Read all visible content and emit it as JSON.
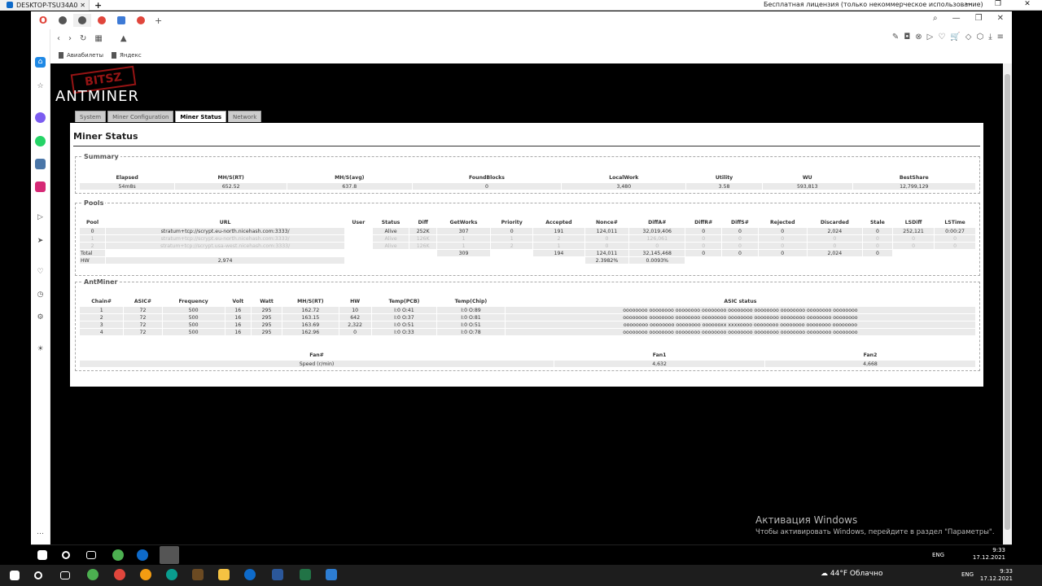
{
  "tv": {
    "tab_title": "DESKTOP-TSU34A0",
    "license": "Бесплатная лицензия (только некоммерческое использование)",
    "plus": "+"
  },
  "browser": {
    "bookmarks": [
      "Авиабилеты",
      "Яндекс"
    ]
  },
  "page": {
    "brand": "ANTMINER",
    "stamp": "BITSZ",
    "tabs": [
      "System",
      "Miner Configuration",
      "Miner Status",
      "Network"
    ],
    "active_tab": "Miner Status",
    "title": "Miner Status"
  },
  "summary": {
    "legend": "Summary",
    "headers": [
      "Elapsed",
      "MH/S(RT)",
      "MH/S(avg)",
      "FoundBlocks",
      "LocalWork",
      "Utility",
      "WU",
      "BestShare"
    ],
    "values": [
      "54m8s",
      "652.52",
      "637.8",
      "0",
      "3,480",
      "3.58",
      "593,813",
      "12,799,129"
    ]
  },
  "pools": {
    "legend": "Pools",
    "headers": [
      "Pool",
      "URL",
      "User",
      "Status",
      "Diff",
      "GetWorks",
      "Priority",
      "Accepted",
      "Nonce#",
      "DiffA#",
      "DiffR#",
      "DiffS#",
      "Rejected",
      "Discarded",
      "Stale",
      "LSDiff",
      "LSTime"
    ],
    "rows": [
      [
        "0",
        "stratum+tcp://scrypt.eu-north.nicehash.com:3333/",
        "",
        "Alive",
        "252K",
        "307",
        "0",
        "191",
        "124,011",
        "32,019,406",
        "0",
        "0",
        "0",
        "2,024",
        "0",
        "252,121",
        "0:00:27"
      ],
      [
        "1",
        "stratum+tcp://scrypt.eu-north.nicehash.com:3333/",
        "",
        "Alive",
        "126K",
        "1",
        "1",
        "2",
        "0",
        "126,061",
        "0",
        "0",
        "0",
        "0",
        "0",
        "0",
        "0"
      ],
      [
        "2",
        "stratum+tcp://scrypt.usa-west.nicehash.com:3333/",
        "",
        "Alive",
        "126K",
        "1",
        "2",
        "1",
        "0",
        "0",
        "0",
        "0",
        "0",
        "0",
        "0",
        "0",
        "0"
      ]
    ],
    "total": [
      "Total",
      "",
      "",
      "",
      "",
      "309",
      "",
      "194",
      "124,011",
      "32,145,468",
      "0",
      "0",
      "0",
      "2,024",
      "0",
      "",
      ""
    ],
    "hw": [
      "HW",
      "2,974",
      "",
      "",
      "",
      "",
      "",
      "",
      "2.3982%",
      "0.0093%",
      "",
      "",
      "",
      "",
      "",
      "",
      ""
    ]
  },
  "antminer": {
    "legend": "AntMiner",
    "headers": [
      "Chain#",
      "ASIC#",
      "Frequency",
      "Volt",
      "Watt",
      "MH/S(RT)",
      "HW",
      "Temp(PCB)",
      "Temp(Chip)",
      "ASIC status"
    ],
    "rows": [
      [
        "1",
        "72",
        "500",
        "16",
        "295",
        "162.72",
        "10",
        "I:0 O:41",
        "I:0 O:89",
        "oooooooo oooooooo oooooooo oooooooo oooooooo oooooooo oooooooo oooooooo oooooooo"
      ],
      [
        "2",
        "72",
        "500",
        "16",
        "295",
        "163.15",
        "642",
        "I:0 O:37",
        "I:0 O:81",
        "oooooooo oooooooo oooooooo oooooooo oooooooo oooooooo oooooooo oooooooo oooooooo"
      ],
      [
        "3",
        "72",
        "500",
        "16",
        "295",
        "163.69",
        "2,322",
        "I:0 O:51",
        "I:0 O:51",
        "oooooooo oooooooo oooooooo ooooooxx xxxxoooo oooooooo oooooooo oooooooo oooooooo"
      ],
      [
        "4",
        "72",
        "500",
        "16",
        "295",
        "162.96",
        "0",
        "I:0 O:33",
        "I:0 O:78",
        "oooooooo oooooooo oooooooo oooooooo oooooooo oooooooo oooooooo oooooooo oooooooo"
      ]
    ],
    "fan_headers": [
      "Fan#",
      "Fan1",
      "Fan2"
    ],
    "fan_row": [
      "Speed (r/min)",
      "4,632",
      "4,668"
    ]
  },
  "watermark": {
    "title": "Активация Windows",
    "text": "Чтобы активировать Windows, перейдите в раздел \"Параметры\"."
  },
  "taskbar_inner": {
    "time": "9:33",
    "date": "17.12.2021",
    "lang": "ENG"
  },
  "taskbar_outer": {
    "time": "9:33",
    "date": "17.12.2021",
    "lang": "ENG",
    "weather": "44°F  Облачно"
  },
  "colors": {
    "accent_red": "#e0463c",
    "page_bg": "#000000"
  }
}
